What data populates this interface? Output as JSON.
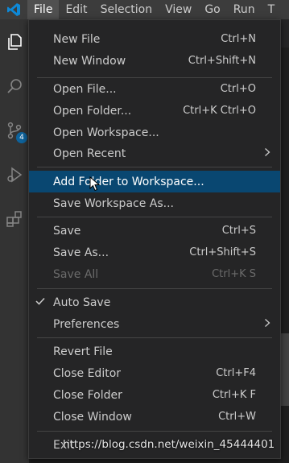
{
  "menubar": {
    "items": [
      "File",
      "Edit",
      "Selection",
      "View",
      "Go",
      "Run",
      "T"
    ],
    "active_index": 0
  },
  "activitybar": {
    "icons": [
      "explorer-icon",
      "search-icon",
      "source-control-icon",
      "run-debug-icon",
      "extensions-icon"
    ],
    "scm_badge": "4"
  },
  "file_menu": {
    "items": [
      {
        "label": "New File",
        "shortcut": "Ctrl+N"
      },
      {
        "label": "New Window",
        "shortcut": "Ctrl+Shift+N"
      },
      {
        "label": "Open File...",
        "shortcut": "Ctrl+O"
      },
      {
        "label": "Open Folder...",
        "shortcut": "Ctrl+K Ctrl+O"
      },
      {
        "label": "Open Workspace...",
        "shortcut": ""
      },
      {
        "label": "Open Recent",
        "shortcut": "",
        "submenu": true
      },
      {
        "label": "Add Folder to Workspace...",
        "shortcut": "",
        "selected": true
      },
      {
        "label": "Save Workspace As...",
        "shortcut": ""
      },
      {
        "label": "Save",
        "shortcut": "Ctrl+S"
      },
      {
        "label": "Save As...",
        "shortcut": "Ctrl+Shift+S"
      },
      {
        "label": "Save All",
        "shortcut": "Ctrl+K S",
        "disabled": true
      },
      {
        "label": "Auto Save",
        "shortcut": "",
        "checked": true
      },
      {
        "label": "Preferences",
        "shortcut": "",
        "submenu": true
      },
      {
        "label": "Revert File",
        "shortcut": ""
      },
      {
        "label": "Close Editor",
        "shortcut": "Ctrl+F4"
      },
      {
        "label": "Close Folder",
        "shortcut": "Ctrl+K F"
      },
      {
        "label": "Close Window",
        "shortcut": "Ctrl+W"
      },
      {
        "label": "Exit",
        "shortcut": ""
      }
    ]
  },
  "watermark": "https://blog.csdn.net/weixin_45444401",
  "colors": {
    "menu_bg": "#252526",
    "selection_bg": "#094771",
    "menubar_bg": "#3c3c3c",
    "activitybar_bg": "#333333",
    "brand_blue": "#0078d4"
  }
}
